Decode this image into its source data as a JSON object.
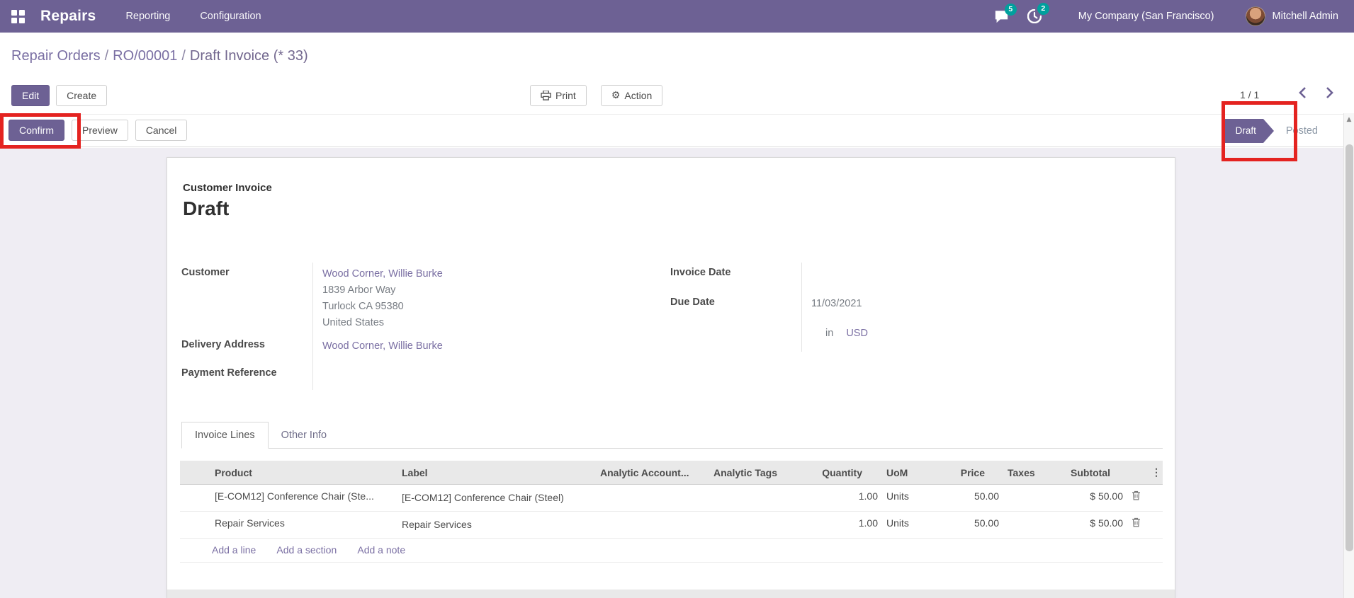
{
  "topbar": {
    "app_name": "Repairs",
    "menus": [
      "Reporting",
      "Configuration"
    ],
    "messages_count": "5",
    "activities_count": "2",
    "company": "My Company (San Francisco)",
    "user": "Mitchell Admin"
  },
  "breadcrumb": {
    "links": [
      "Repair Orders",
      "RO/00001"
    ],
    "separator": "/",
    "current": "Draft Invoice (* 33)"
  },
  "control_panel": {
    "edit": "Edit",
    "create": "Create",
    "print": "Print",
    "action": "Action",
    "pager": "1 / 1"
  },
  "statusbar": {
    "buttons": {
      "confirm": "Confirm",
      "preview": "Preview",
      "cancel": "Cancel"
    },
    "states": {
      "draft": "Draft",
      "posted": "Posted"
    }
  },
  "document": {
    "type_label": "Customer Invoice",
    "state_title": "Draft",
    "fields": {
      "customer_label": "Customer",
      "customer_name": "Wood Corner, Willie Burke",
      "address_line1": "1839 Arbor Way",
      "address_line2": "Turlock CA 95380",
      "address_line3": "United States",
      "delivery_label": "Delivery Address",
      "delivery_value": "Wood Corner, Willie Burke",
      "payment_ref_label": "Payment Reference",
      "invoice_date_label": "Invoice Date",
      "due_date_label": "Due Date",
      "due_date_value": "11/03/2021",
      "currency_prefix": "in",
      "currency": "USD"
    },
    "tabs": {
      "invoice_lines": "Invoice Lines",
      "other_info": "Other Info"
    },
    "lines_table": {
      "headers": {
        "product": "Product",
        "label": "Label",
        "analytic_account": "Analytic Account...",
        "analytic_tags": "Analytic Tags",
        "quantity": "Quantity",
        "uom": "UoM",
        "price": "Price",
        "taxes": "Taxes",
        "subtotal": "Subtotal"
      },
      "rows": [
        {
          "product": "[E-COM12] Conference Chair (Ste...",
          "label": "[E-COM12] Conference Chair (Steel)",
          "quantity": "1.00",
          "uom": "Units",
          "price": "50.00",
          "taxes": "",
          "subtotal": "$ 50.00"
        },
        {
          "product": "Repair Services",
          "label": "Repair Services",
          "quantity": "1.00",
          "uom": "Units",
          "price": "50.00",
          "taxes": "",
          "subtotal": "$ 50.00"
        }
      ],
      "footer_links": [
        "Add a line",
        "Add a section",
        "Add a note"
      ]
    }
  },
  "icons": {
    "apps": "grid-icon",
    "messages": "chat-bubble-icon",
    "activities": "clock-icon",
    "print": "printer-icon",
    "action": "gear-icon",
    "pager_prev": "chevron-left-icon",
    "pager_next": "chevron-right-icon",
    "delete_row": "trash-icon",
    "column_options": "vertical-dots-icon",
    "scroll": "up-arrow-icon"
  },
  "colors": {
    "primary": "#6d6194",
    "badge_teal": "#00a09d",
    "link": "#7a6fa3",
    "annotation_red": "#e42320"
  }
}
